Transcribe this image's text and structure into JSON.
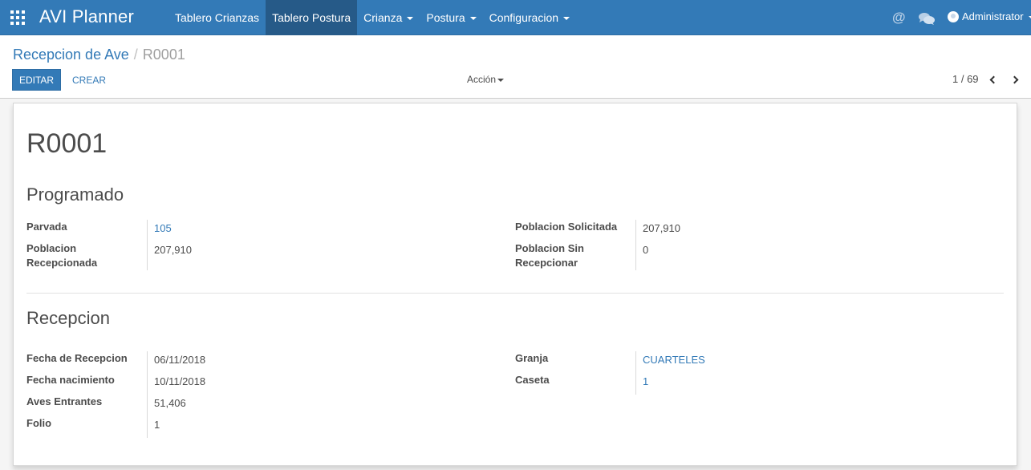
{
  "navbar": {
    "app_title": "AVI Planner",
    "menu": [
      {
        "label": "Tablero Crianzas",
        "active": false,
        "dropdown": false
      },
      {
        "label": "Tablero Postura",
        "active": true,
        "dropdown": false
      },
      {
        "label": "Crianza",
        "active": false,
        "dropdown": true
      },
      {
        "label": "Postura",
        "active": false,
        "dropdown": true
      },
      {
        "label": "Configuracion",
        "active": false,
        "dropdown": true
      }
    ],
    "icons": [
      "apps-grid-icon",
      "at-icon",
      "chat-icon",
      "user-avatar-icon"
    ],
    "at_symbol": "@",
    "user_name": "Administrator"
  },
  "breadcrumb": {
    "parent": "Recepcion de Ave",
    "separator": "/",
    "current": "R0001"
  },
  "buttons": {
    "edit": "EDITAR",
    "create": "CREAR",
    "action": "Acción"
  },
  "pager": {
    "value": "1 / 69"
  },
  "form": {
    "title": "R0001",
    "sections": {
      "programado": {
        "title": "Programado",
        "parvada_label": "Parvada",
        "parvada_value": "105",
        "poblacion_recepcionada_label_1": "Poblacion",
        "poblacion_recepcionada_label_2": "Recepcionada",
        "poblacion_recepcionada_value": "207,910",
        "poblacion_solicitada_label": "Poblacion Solicitada",
        "poblacion_solicitada_value": "207,910",
        "poblacion_sin_recepcionar_label_1": "Poblacion Sin",
        "poblacion_sin_recepcionar_label_2": "Recepcionar",
        "poblacion_sin_recepcionar_value": "0"
      },
      "recepcion": {
        "title": "Recepcion",
        "fecha_recepcion_label": "Fecha de Recepcion",
        "fecha_recepcion_value": "06/11/2018",
        "fecha_nacimiento_label": "Fecha nacimiento",
        "fecha_nacimiento_value": "10/11/2018",
        "aves_entrantes_label": "Aves Entrantes",
        "aves_entrantes_value": "51,406",
        "folio_label": "Folio",
        "folio_value": "1",
        "granja_label": "Granja",
        "granja_value": "CUARTELES",
        "caseta_label": "Caseta",
        "caseta_value": "1"
      }
    }
  },
  "colors": {
    "navbar": "#337ab7",
    "active_menu": "#265a88",
    "link": "#337ab7",
    "text": "#4c4c4c"
  }
}
